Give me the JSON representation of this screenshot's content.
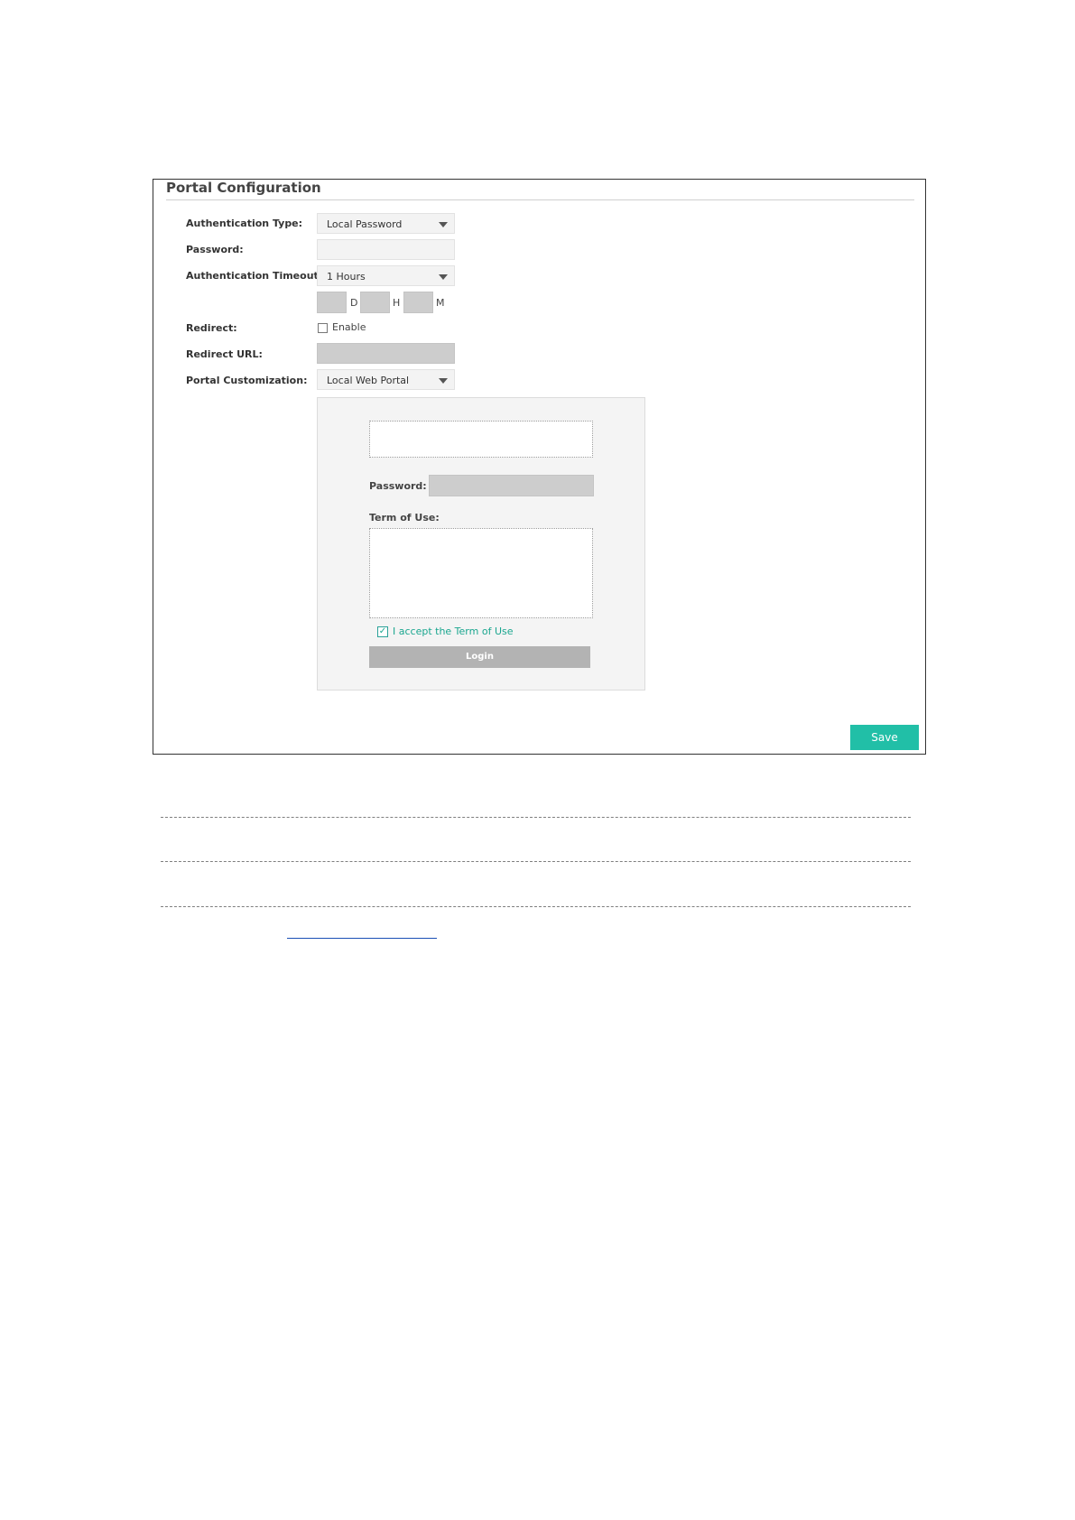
{
  "panel": {
    "title": "Portal Configuration"
  },
  "form": {
    "auth_type_label": "Authentication Type:",
    "auth_type_value": "Local Password",
    "password_label": "Password:",
    "password_value": "",
    "timeout_label": "Authentication Timeout:",
    "timeout_value": "1 Hours",
    "timeout_units": {
      "days": "D",
      "hours": "H",
      "minutes": "M"
    },
    "redirect_label": "Redirect:",
    "redirect_enable_label": "Enable",
    "redirect_enabled": false,
    "redirect_url_label": "Redirect URL:",
    "customization_label": "Portal Customization:",
    "customization_value": "Local Web Portal"
  },
  "preview": {
    "password_label": "Password:",
    "terms_label": "Term of Use:",
    "accept_text": "I accept the Term of Use",
    "accept_checked": true,
    "login_label": "Login"
  },
  "actions": {
    "save_label": "Save"
  },
  "colors": {
    "accent": "#21bfa7",
    "accept_text": "#1aa68f",
    "login_button": "#b3b3b3"
  },
  "icons": {
    "dropdown": "chevron-down-icon",
    "checkbox": "checkbox-icon",
    "checkmark": "checkmark-icon"
  }
}
